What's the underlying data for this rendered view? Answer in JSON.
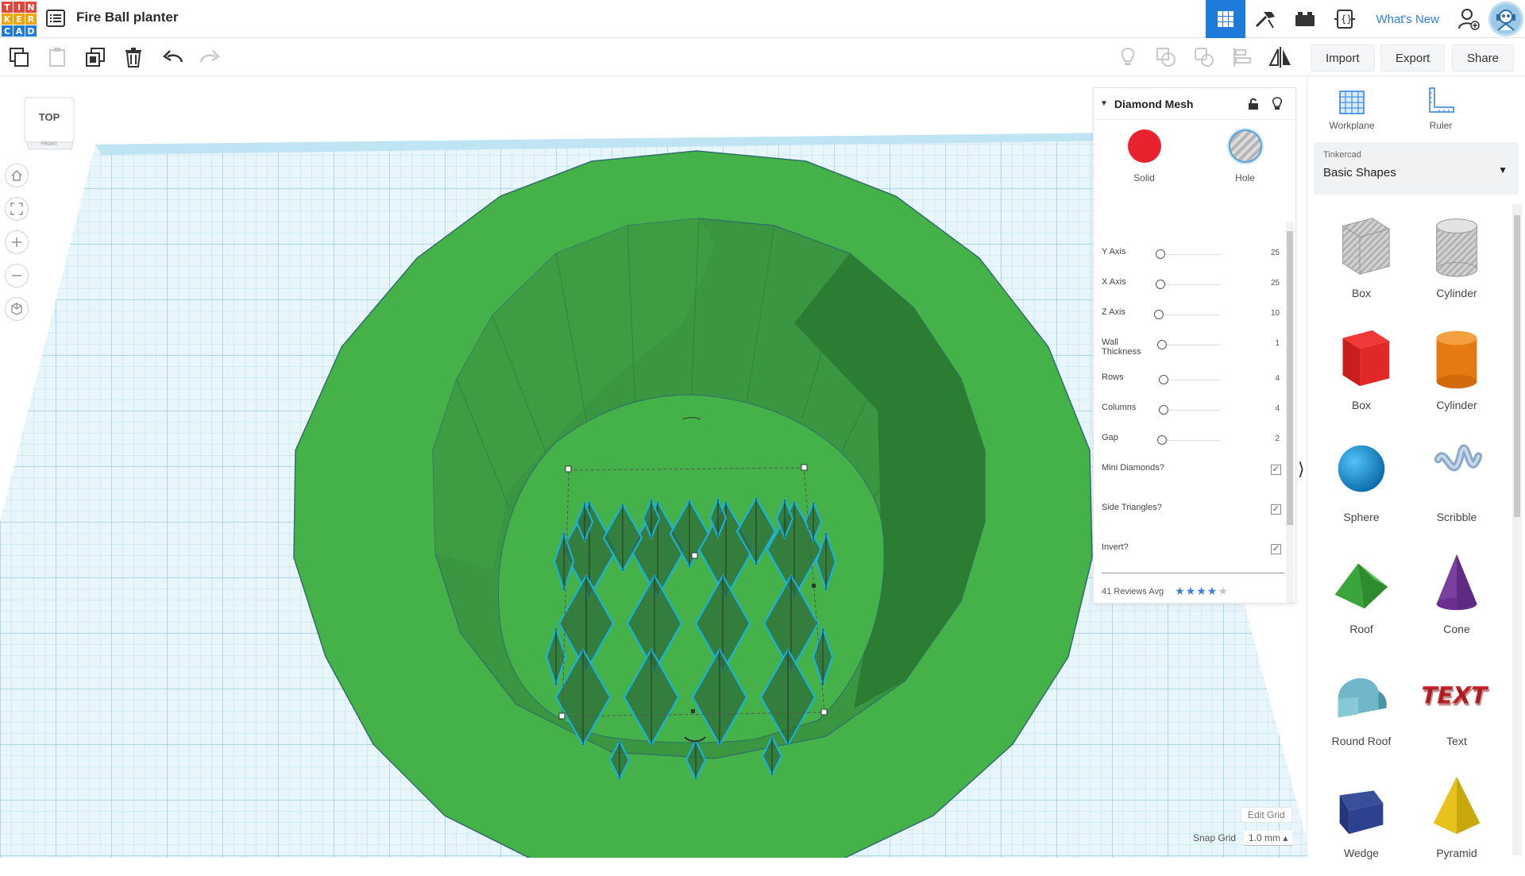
{
  "header": {
    "logo_letters": [
      "T",
      "I",
      "N",
      "K",
      "E",
      "R",
      "C",
      "A",
      "D"
    ],
    "logo_colors": [
      "#e64438",
      "#e64438",
      "#e64438",
      "#f5a300",
      "#f5a300",
      "#f5a300",
      "#1f7bd9",
      "#1f7bd9",
      "#1f7bd9"
    ],
    "project_title": "Fire Ball planter",
    "whats_new": "What's New",
    "icons": [
      "3d-view-icon",
      "build-hammer-icon",
      "bricks-icon",
      "codeblocks-icon"
    ]
  },
  "toolbar": {
    "import_label": "Import",
    "export_label": "Export",
    "share_label": "Share"
  },
  "viewcube": {
    "top_label": "TOP",
    "front_label": "FRONT"
  },
  "inspector": {
    "title": "Diamond Mesh",
    "solid_label": "Solid",
    "hole_label": "Hole",
    "solid_color": "#e8232f",
    "properties": [
      {
        "label": "Y Axis",
        "value": "25",
        "knob": 0.05
      },
      {
        "label": "X Axis",
        "value": "25",
        "knob": 0.05
      },
      {
        "label": "Z Axis",
        "value": "10",
        "knob": 0.03
      },
      {
        "label": "Wall Thickness",
        "value": "1",
        "knob": 0.08
      },
      {
        "label": "Rows",
        "value": "4",
        "knob": 0.1
      },
      {
        "label": "Columns",
        "value": "4",
        "knob": 0.1
      },
      {
        "label": "Gap",
        "value": "2",
        "knob": 0.08
      }
    ],
    "checkboxes": [
      {
        "label": "Mini Diamonds?",
        "checked": true
      },
      {
        "label": "Side Triangles?",
        "checked": true
      },
      {
        "label": "Invert?",
        "checked": true
      }
    ],
    "reviews": "41 Reviews Avg",
    "rating": 4
  },
  "library": {
    "workplane_label": "Workplane",
    "ruler_label": "Ruler",
    "source_label": "Tinkercad",
    "category": "Basic Shapes",
    "shapes": [
      {
        "name": "Box",
        "kind": "box-hole"
      },
      {
        "name": "Cylinder",
        "kind": "cyl-hole"
      },
      {
        "name": "Box",
        "kind": "box-red"
      },
      {
        "name": "Cylinder",
        "kind": "cyl-orange"
      },
      {
        "name": "Sphere",
        "kind": "sphere"
      },
      {
        "name": "Scribble",
        "kind": "scribble"
      },
      {
        "name": "Roof",
        "kind": "roof"
      },
      {
        "name": "Cone",
        "kind": "cone"
      },
      {
        "name": "Round Roof",
        "kind": "roundroof"
      },
      {
        "name": "Text",
        "kind": "text"
      },
      {
        "name": "Wedge",
        "kind": "wedge"
      },
      {
        "name": "Pyramid",
        "kind": "pyramid"
      }
    ]
  },
  "grid": {
    "edit_grid": "Edit Grid",
    "snap_grid": "Snap Grid",
    "snap_value": "1.0 mm"
  }
}
